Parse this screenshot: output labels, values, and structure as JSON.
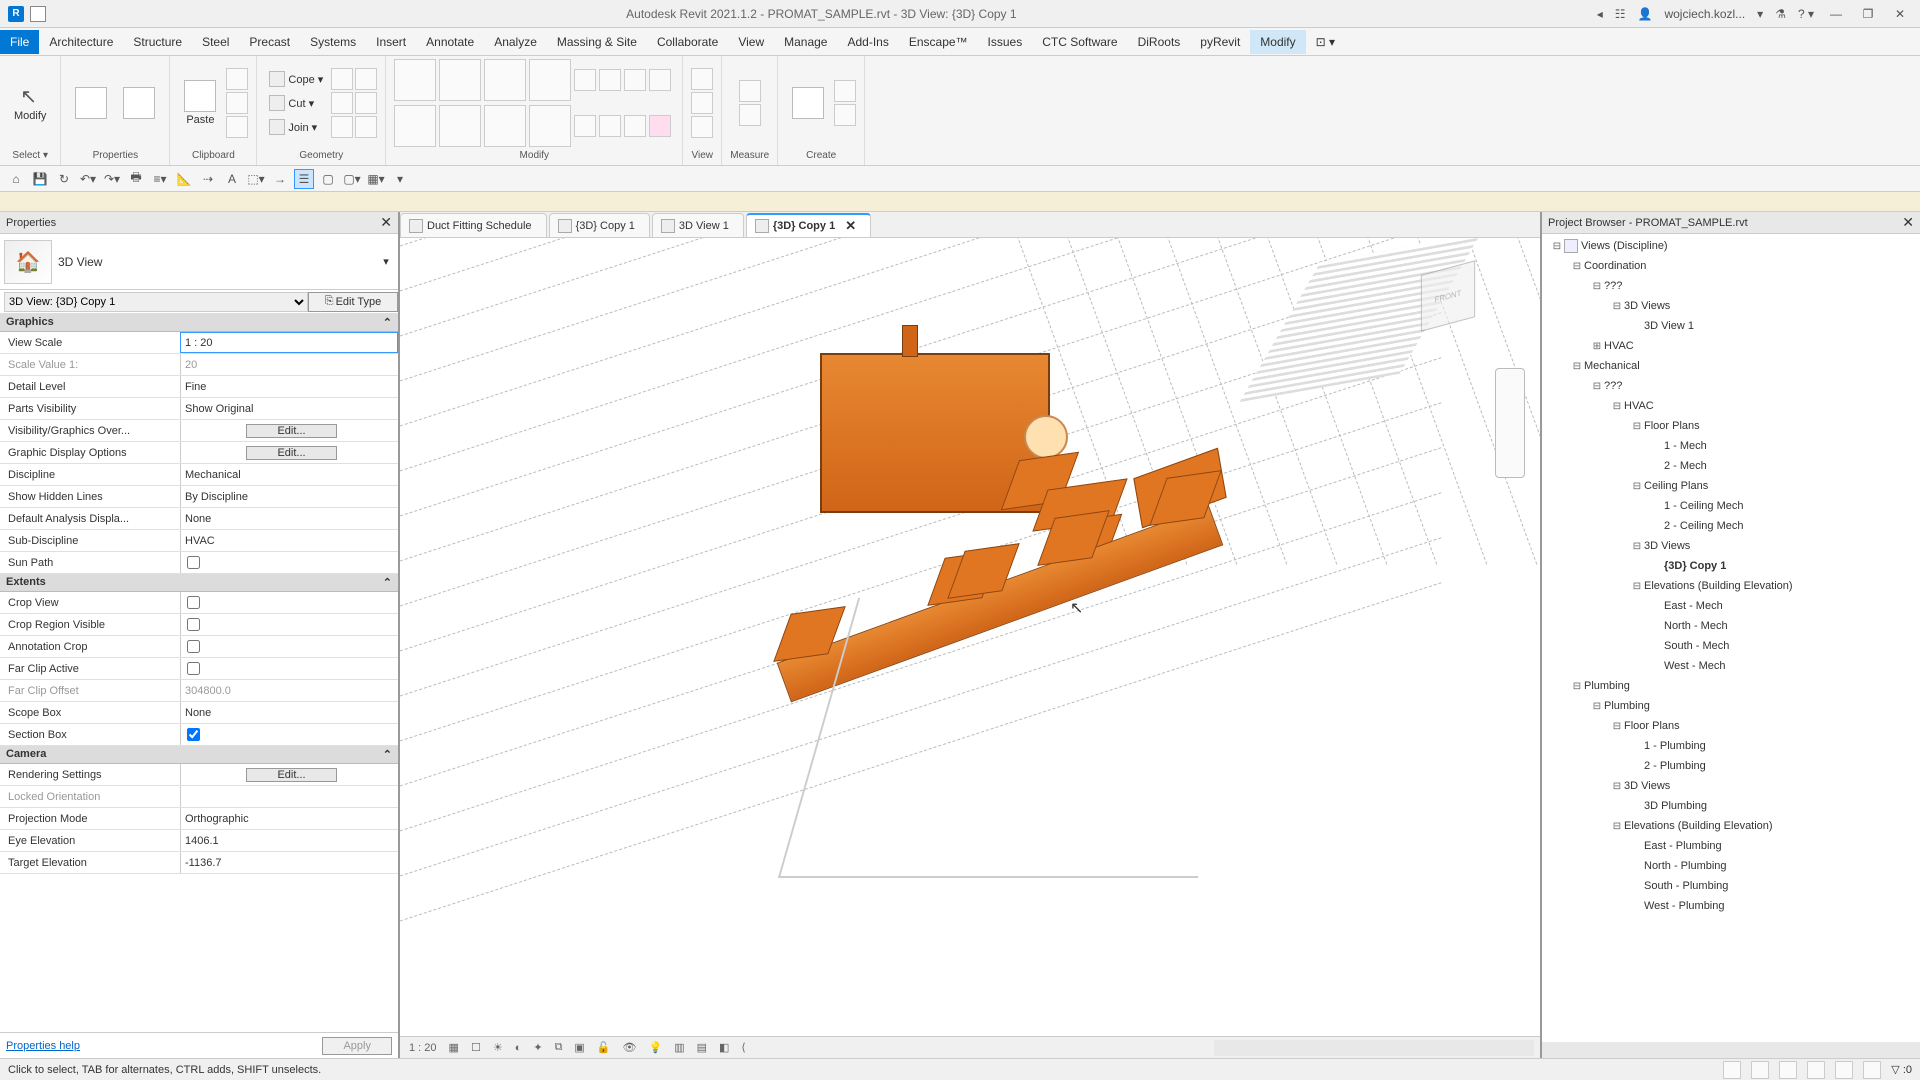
{
  "titlebar": {
    "title": "Autodesk Revit 2021.1.2 - PROMAT_SAMPLE.rvt - 3D View: {3D} Copy 1",
    "user": "wojciech.kozl..."
  },
  "menus": [
    "File",
    "Architecture",
    "Structure",
    "Steel",
    "Precast",
    "Systems",
    "Insert",
    "Annotate",
    "Analyze",
    "Massing & Site",
    "Collaborate",
    "View",
    "Manage",
    "Add-Ins",
    "Enscape™",
    "Issues",
    "CTC Software",
    "DiRoots",
    "pyRevit",
    "Modify"
  ],
  "ribbon": {
    "select": {
      "modify": "Modify",
      "label": "Select ▾"
    },
    "properties": {
      "btn": "Properties",
      "label": "Properties"
    },
    "clipboard": {
      "paste": "Paste",
      "label": "Clipboard"
    },
    "geometry": {
      "cope": "Cope ▾",
      "cut": "Cut ▾",
      "join": "Join ▾",
      "label": "Geometry"
    },
    "modify": {
      "label": "Modify"
    },
    "view": {
      "label": "View"
    },
    "measure": {
      "label": "Measure"
    },
    "create": {
      "label": "Create"
    }
  },
  "properties": {
    "title": "Properties",
    "type_name": "3D View",
    "instance_sel": "3D View: {3D} Copy 1",
    "edit_type": "Edit Type",
    "sections": {
      "graphics": "Graphics",
      "extents": "Extents",
      "camera": "Camera"
    },
    "rows": {
      "view_scale": {
        "l": "View Scale",
        "v": "1 : 20"
      },
      "scale_value": {
        "l": "Scale Value    1:",
        "v": "20"
      },
      "detail_level": {
        "l": "Detail Level",
        "v": "Fine"
      },
      "parts_vis": {
        "l": "Parts Visibility",
        "v": "Show Original"
      },
      "vg": {
        "l": "Visibility/Graphics Over...",
        "v": "Edit..."
      },
      "gdo": {
        "l": "Graphic Display Options",
        "v": "Edit..."
      },
      "discipline": {
        "l": "Discipline",
        "v": "Mechanical"
      },
      "hidden": {
        "l": "Show Hidden Lines",
        "v": "By Discipline"
      },
      "analysis": {
        "l": "Default Analysis Displa...",
        "v": "None"
      },
      "subdisc": {
        "l": "Sub-Discipline",
        "v": "HVAC"
      },
      "sunpath": {
        "l": "Sun Path",
        "v": false
      },
      "cropview": {
        "l": "Crop View",
        "v": false
      },
      "croprgn": {
        "l": "Crop Region Visible",
        "v": false
      },
      "anncrop": {
        "l": "Annotation Crop",
        "v": false
      },
      "farclip": {
        "l": "Far Clip Active",
        "v": false
      },
      "farclipoff": {
        "l": "Far Clip Offset",
        "v": "304800.0"
      },
      "scopebox": {
        "l": "Scope Box",
        "v": "None"
      },
      "sectionbox": {
        "l": "Section Box",
        "v": true
      },
      "render": {
        "l": "Rendering Settings",
        "v": "Edit..."
      },
      "lockorient": {
        "l": "Locked Orientation",
        "v": ""
      },
      "projmode": {
        "l": "Projection Mode",
        "v": "Orthographic"
      },
      "eyeelev": {
        "l": "Eye Elevation",
        "v": "1406.1"
      },
      "targetelev": {
        "l": "Target Elevation",
        "v": "-1136.7"
      }
    },
    "help": "Properties help",
    "apply": "Apply"
  },
  "tabs": [
    {
      "name": "Duct Fitting Schedule",
      "active": false
    },
    {
      "name": "{3D} Copy 1",
      "active": false
    },
    {
      "name": "3D View 1",
      "active": false
    },
    {
      "name": "{3D} Copy 1",
      "active": true
    }
  ],
  "viewbar": {
    "scale": "1 : 20"
  },
  "browser": {
    "title": "Project Browser - PROMAT_SAMPLE.rvt",
    "tree": [
      {
        "d": 0,
        "t": "−",
        "ic": 1,
        "l": "Views (Discipline)"
      },
      {
        "d": 1,
        "t": "−",
        "l": "Coordination"
      },
      {
        "d": 2,
        "t": "−",
        "l": "???"
      },
      {
        "d": 3,
        "t": "−",
        "l": "3D Views"
      },
      {
        "d": 4,
        "t": "",
        "l": "3D View 1"
      },
      {
        "d": 2,
        "t": "+",
        "l": "HVAC"
      },
      {
        "d": 1,
        "t": "−",
        "l": "Mechanical"
      },
      {
        "d": 2,
        "t": "−",
        "l": "???"
      },
      {
        "d": 3,
        "t": "−",
        "l": "HVAC"
      },
      {
        "d": 4,
        "t": "−",
        "l": "Floor Plans"
      },
      {
        "d": 5,
        "t": "",
        "l": "1 - Mech"
      },
      {
        "d": 5,
        "t": "",
        "l": "2 - Mech"
      },
      {
        "d": 4,
        "t": "−",
        "l": "Ceiling Plans"
      },
      {
        "d": 5,
        "t": "",
        "l": "1 - Ceiling Mech"
      },
      {
        "d": 5,
        "t": "",
        "l": "2 - Ceiling Mech"
      },
      {
        "d": 4,
        "t": "−",
        "l": "3D Views"
      },
      {
        "d": 5,
        "t": "",
        "l": "{3D} Copy 1",
        "b": 1
      },
      {
        "d": 4,
        "t": "−",
        "l": "Elevations (Building Elevation)"
      },
      {
        "d": 5,
        "t": "",
        "l": "East - Mech"
      },
      {
        "d": 5,
        "t": "",
        "l": "North - Mech"
      },
      {
        "d": 5,
        "t": "",
        "l": "South - Mech"
      },
      {
        "d": 5,
        "t": "",
        "l": "West - Mech"
      },
      {
        "d": 1,
        "t": "−",
        "l": "Plumbing"
      },
      {
        "d": 2,
        "t": "−",
        "l": "Plumbing"
      },
      {
        "d": 3,
        "t": "−",
        "l": "Floor Plans"
      },
      {
        "d": 4,
        "t": "",
        "l": "1 - Plumbing"
      },
      {
        "d": 4,
        "t": "",
        "l": "2 - Plumbing"
      },
      {
        "d": 3,
        "t": "−",
        "l": "3D Views"
      },
      {
        "d": 4,
        "t": "",
        "l": "3D Plumbing"
      },
      {
        "d": 3,
        "t": "−",
        "l": "Elevations (Building Elevation)"
      },
      {
        "d": 4,
        "t": "",
        "l": "East - Plumbing"
      },
      {
        "d": 4,
        "t": "",
        "l": "North - Plumbing"
      },
      {
        "d": 4,
        "t": "",
        "l": "South - Plumbing"
      },
      {
        "d": 4,
        "t": "",
        "l": "West - Plumbing"
      }
    ]
  },
  "status": {
    "hint": "Click to select, TAB for alternates, CTRL adds, SHIFT unselects.",
    "filter": "▽ :0"
  }
}
